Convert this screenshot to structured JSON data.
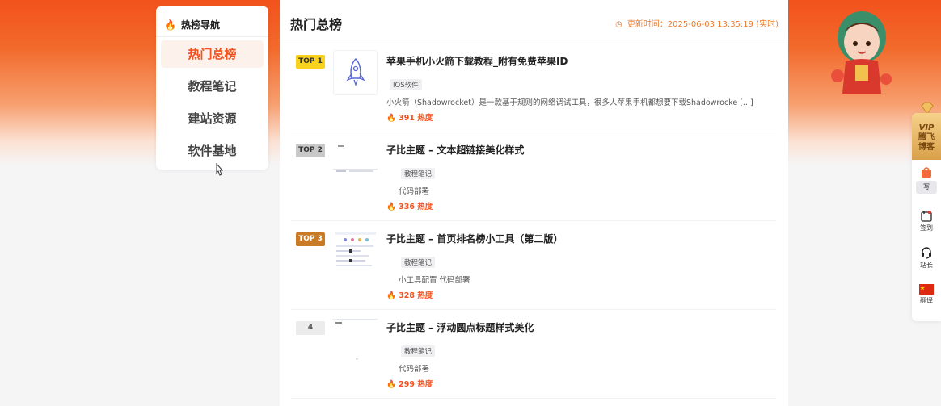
{
  "nav": {
    "header": "热榜导航",
    "items": [
      {
        "label": "热门总榜",
        "active": true
      },
      {
        "label": "教程笔记",
        "active": false
      },
      {
        "label": "建站资源",
        "active": false
      },
      {
        "label": "软件基地",
        "active": false
      }
    ]
  },
  "main": {
    "title": "热门总榜",
    "update_text": "更新时间：2025-06-03 13:35:19 (实时)",
    "items": [
      {
        "rank": "TOP 1",
        "title": "苹果手机小火箭下载教程_附有免费苹果ID",
        "tag": "IOS软件",
        "desc": "小火箭（Shadowrocket）是一款基于规则的网络调试工具，很多人苹果手机都想要下载Shadowrocke [...]",
        "heat": "391 热度"
      },
      {
        "rank": "TOP 2",
        "title": "子比主题 – 文本超链接美化样式",
        "tag": "教程笔记",
        "desc": "代码部署",
        "heat": "336 热度"
      },
      {
        "rank": "TOP 3",
        "title": "子比主题 – 首页排名榜小工具（第二版）",
        "tag": "教程笔记",
        "desc": "小工具配置 代码部署",
        "heat": "328 热度"
      },
      {
        "rank": "4",
        "title": "子比主题 – 浮动圆点标题样式美化",
        "tag": "教程笔记",
        "desc": "代码部署",
        "heat": "299 热度"
      }
    ]
  },
  "sidebar": {
    "vip_line1": "VIP",
    "vip_line2": "腾飞",
    "vip_line3": "博客",
    "write": "写",
    "checkin": "签到",
    "admin": "站长",
    "translate": "翻译"
  },
  "colors": {
    "accent": "#f4511e",
    "top1": "#f8d21c",
    "top2": "#c8c8c8",
    "top3": "#c97a26"
  }
}
